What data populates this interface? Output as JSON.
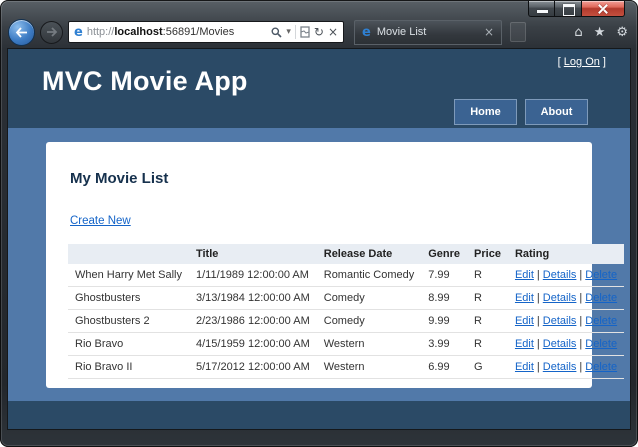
{
  "browser": {
    "address": {
      "prefix": "http://",
      "host": "localhost",
      "path": ":56891/Movies"
    },
    "tab": {
      "title": "Movie List",
      "close_glyph": "×"
    },
    "icons": {
      "ie_logo": "e",
      "dropdown": "▾",
      "refresh": "↻",
      "stop": "×",
      "home": "⌂",
      "favorites": "★",
      "tools": "⚙"
    }
  },
  "page": {
    "logon": {
      "open_bracket": "[ ",
      "label": "Log On",
      "close_bracket": " ]"
    },
    "app_title": "MVC Movie App",
    "nav": {
      "home": "Home",
      "about": "About"
    },
    "heading": "My Movie List",
    "create_link": "Create New",
    "table": {
      "headers": [
        "",
        "Title",
        "Release Date",
        "Genre",
        "Price",
        "Rating"
      ],
      "rows": [
        {
          "cells": [
            "When Harry Met Sally",
            "1/11/1989 12:00:00 AM",
            "Romantic Comedy",
            "7.99",
            "R"
          ]
        },
        {
          "cells": [
            "Ghostbusters",
            "3/13/1984 12:00:00 AM",
            "Comedy",
            "8.99",
            "R"
          ]
        },
        {
          "cells": [
            "Ghostbusters 2",
            "2/23/1986 12:00:00 AM",
            "Comedy",
            "9.99",
            "R"
          ]
        },
        {
          "cells": [
            "Rio Bravo",
            "4/15/1959 12:00:00 AM",
            "Western",
            "3.99",
            "R"
          ]
        },
        {
          "cells": [
            "Rio Bravo II",
            "5/17/2012 12:00:00 AM",
            "Western",
            "6.99",
            "G"
          ]
        }
      ],
      "actions": [
        "Edit",
        "Details",
        "Delete"
      ],
      "action_separator": "|"
    }
  }
}
